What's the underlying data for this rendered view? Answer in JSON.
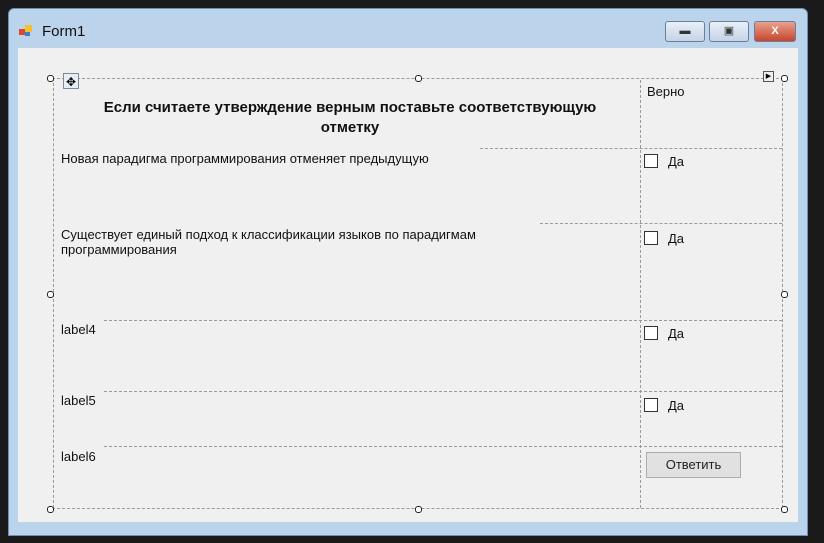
{
  "window": {
    "title": "Form1"
  },
  "header": {
    "text": "Если считаете утверждение верным поставьте соответствующую отметку",
    "column_title": "Верно"
  },
  "rows": [
    {
      "label": "Новая парадигма программирования отменяет предыдущую",
      "checkbox": "Да",
      "checked": false
    },
    {
      "label": "Существует единый подход к классификации языков по парадигмам программирования",
      "checkbox": "Да",
      "checked": false
    },
    {
      "label": "label4",
      "checkbox": "Да",
      "checked": false
    },
    {
      "label": "label5",
      "checkbox": "Да",
      "checked": false
    }
  ],
  "last_row": {
    "label": "label6",
    "button": "Ответить"
  }
}
